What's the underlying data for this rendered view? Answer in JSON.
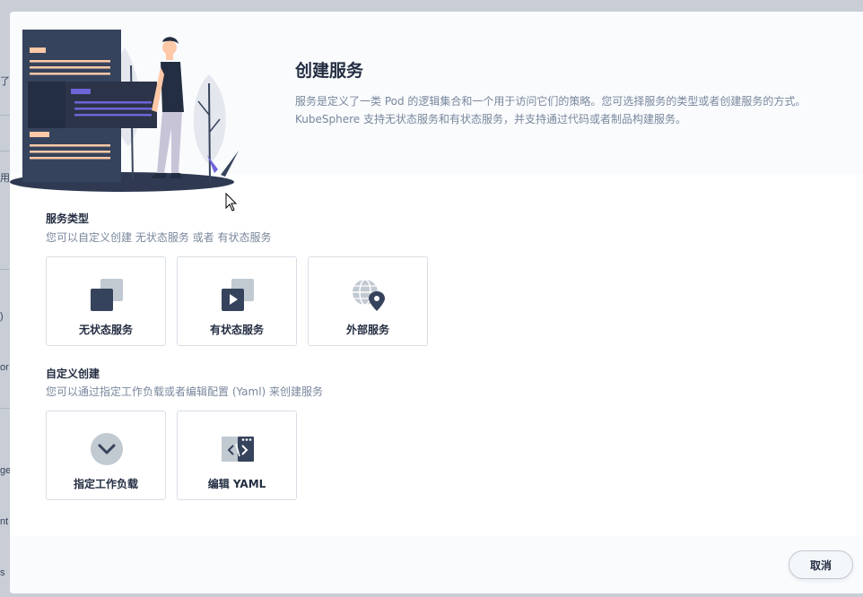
{
  "background": {
    "fragments": [
      "了",
      "用",
      ")",
      "or",
      "ge",
      "nt",
      "s"
    ]
  },
  "hero": {
    "title": "创建服务",
    "description_line1": "服务是定义了一类 Pod 的逻辑集合和一个用于访问它们的策略。您可选择服务的类型或者创建服务的方式。",
    "description_line2": "KubeSphere 支持无状态服务和有状态服务，并支持通过代码或者制品构建服务。"
  },
  "service_type": {
    "title": "服务类型",
    "description": "您可以自定义创建 无状态服务 或者 有状态服务",
    "cards": [
      {
        "label": "无状态服务",
        "icon": "stateless-service-icon"
      },
      {
        "label": "有状态服务",
        "icon": "stateful-service-icon"
      },
      {
        "label": "外部服务",
        "icon": "external-service-icon"
      }
    ]
  },
  "custom_create": {
    "title": "自定义创建",
    "description": "您可以通过指定工作负载或者编辑配置 (Yaml) 来创建服务",
    "cards": [
      {
        "label": "指定工作负载",
        "icon": "chevron-down-icon"
      },
      {
        "label": "编辑 YAML",
        "icon": "code-editor-icon"
      }
    ]
  },
  "footer": {
    "cancel_label": "取消"
  },
  "colors": {
    "primary_dark": "#242e42",
    "muted_text": "#79879c",
    "icon_dark": "#36435c",
    "icon_light": "#c1c9d1",
    "accent_purple": "#55bc8a",
    "border": "#d8dee5"
  }
}
